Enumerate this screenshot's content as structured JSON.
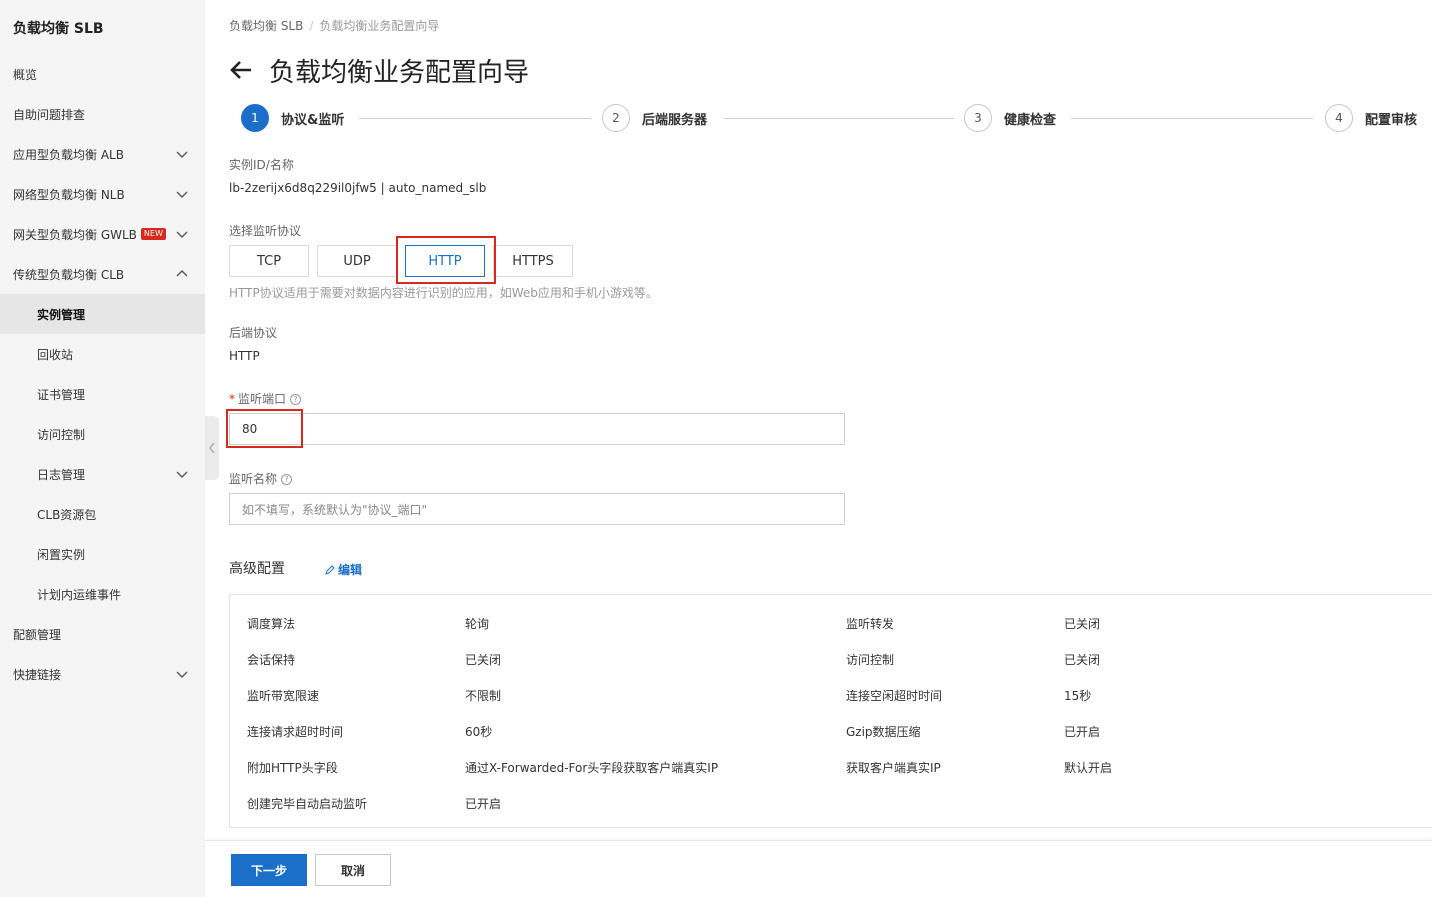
{
  "sidebar": {
    "title": "负载均衡 SLB",
    "items": [
      {
        "label": "概览"
      },
      {
        "label": "自助问题排查"
      },
      {
        "label": "应用型负载均衡 ALB"
      },
      {
        "label": "网络型负载均衡 NLB"
      },
      {
        "label": "网关型负载均衡 GWLB",
        "badge": "NEW"
      },
      {
        "label": "传统型负载均衡 CLB"
      },
      {
        "label": "实例管理"
      },
      {
        "label": "回收站"
      },
      {
        "label": "证书管理"
      },
      {
        "label": "访问控制"
      },
      {
        "label": "日志管理"
      },
      {
        "label": "CLB资源包"
      },
      {
        "label": "闲置实例"
      },
      {
        "label": "计划内运维事件"
      },
      {
        "label": "配额管理"
      },
      {
        "label": "快捷链接"
      }
    ]
  },
  "breadcrumb": {
    "first": "负载均衡 SLB",
    "sep": "/",
    "last": "负载均衡业务配置向导"
  },
  "page": {
    "title": "负载均衡业务配置向导"
  },
  "steps": [
    {
      "num": "1",
      "label": "协议&监听"
    },
    {
      "num": "2",
      "label": "后端服务器"
    },
    {
      "num": "3",
      "label": "健康检查"
    },
    {
      "num": "4",
      "label": "配置审核"
    }
  ],
  "instance": {
    "label": "实例ID/名称",
    "value": "lb-2zerijx6d8q229il0jfw5 | auto_named_slb"
  },
  "protocol": {
    "label": "选择监听协议",
    "options": [
      "TCP",
      "UDP",
      "HTTP",
      "HTTPS"
    ],
    "selected": "HTTP",
    "hint": "HTTP协议适用于需要对数据内容进行识别的应用，如Web应用和手机小游戏等。"
  },
  "backend": {
    "label": "后端协议",
    "value": "HTTP"
  },
  "port": {
    "required_mark": "*",
    "label": "监听端口",
    "help": "?",
    "value": "80"
  },
  "listener_name": {
    "label": "监听名称",
    "help": "?",
    "placeholder": "如不填写，系统默认为\"协议_端口\""
  },
  "advanced": {
    "title": "高级配置",
    "edit_label": "编辑",
    "rows": [
      {
        "k1": "调度算法",
        "v1": "轮询",
        "k2": "监听转发",
        "v2": "已关闭"
      },
      {
        "k1": "会话保持",
        "v1": "已关闭",
        "k2": "访问控制",
        "v2": "已关闭"
      },
      {
        "k1": "监听带宽限速",
        "v1": "不限制",
        "k2": "连接空闲超时时间",
        "v2": "15秒"
      },
      {
        "k1": "连接请求超时时间",
        "v1": "60秒",
        "k2": "Gzip数据压缩",
        "v2": "已开启"
      },
      {
        "k1": "附加HTTP头字段",
        "v1": "通过X-Forwarded-For头字段获取客户端真实IP",
        "k2": "获取客户端真实IP",
        "v2": "默认开启"
      },
      {
        "k1": "创建完毕自动启动监听",
        "v1": "已开启",
        "k2": "",
        "v2": ""
      }
    ]
  },
  "footer": {
    "next_label": "下一步",
    "cancel_label": "取消"
  },
  "colors": {
    "primary": "#1b6fc8",
    "highlight": "#d9291c",
    "badge": "#d9291c"
  }
}
